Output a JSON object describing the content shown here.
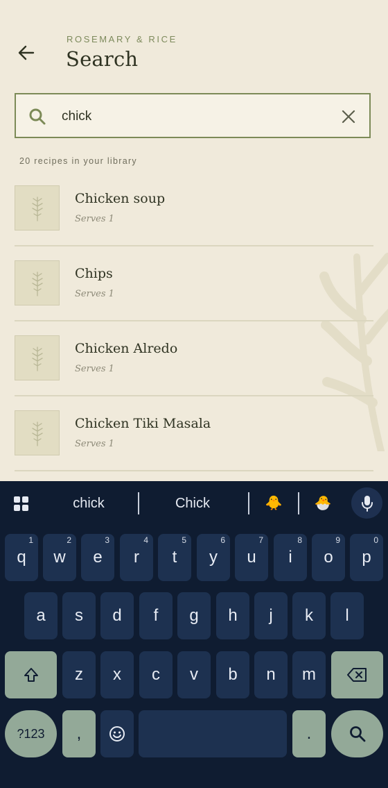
{
  "header": {
    "brand": "ROSEMARY & RICE",
    "title": "Search"
  },
  "search": {
    "value": "chick",
    "placeholder": ""
  },
  "library_count": "20 recipes in your library",
  "recipes": [
    {
      "name": "Chicken soup",
      "serves": "Serves 1"
    },
    {
      "name": "Chips",
      "serves": "Serves 1"
    },
    {
      "name": "Chicken Alredo",
      "serves": "Serves 1"
    },
    {
      "name": "Chicken Tiki Masala",
      "serves": "Serves 1"
    }
  ],
  "keyboard": {
    "suggestions": [
      "chick",
      "Chick",
      "🐥",
      "🐣"
    ],
    "row1": [
      "q",
      "w",
      "e",
      "r",
      "t",
      "y",
      "u",
      "i",
      "o",
      "p"
    ],
    "row1_numbers": [
      "1",
      "2",
      "3",
      "4",
      "5",
      "6",
      "7",
      "8",
      "9",
      "0"
    ],
    "row2": [
      "a",
      "s",
      "d",
      "f",
      "g",
      "h",
      "j",
      "k",
      "l"
    ],
    "row3": [
      "z",
      "x",
      "c",
      "v",
      "b",
      "n",
      "m"
    ],
    "symbols_key": "?123",
    "comma": ",",
    "period": "."
  },
  "colors": {
    "background": "#f0eadb",
    "accent": "#7c8a57",
    "keyboard_bg": "#0f1c31",
    "key_bg": "#1d3150",
    "function_key": "#93a998"
  }
}
